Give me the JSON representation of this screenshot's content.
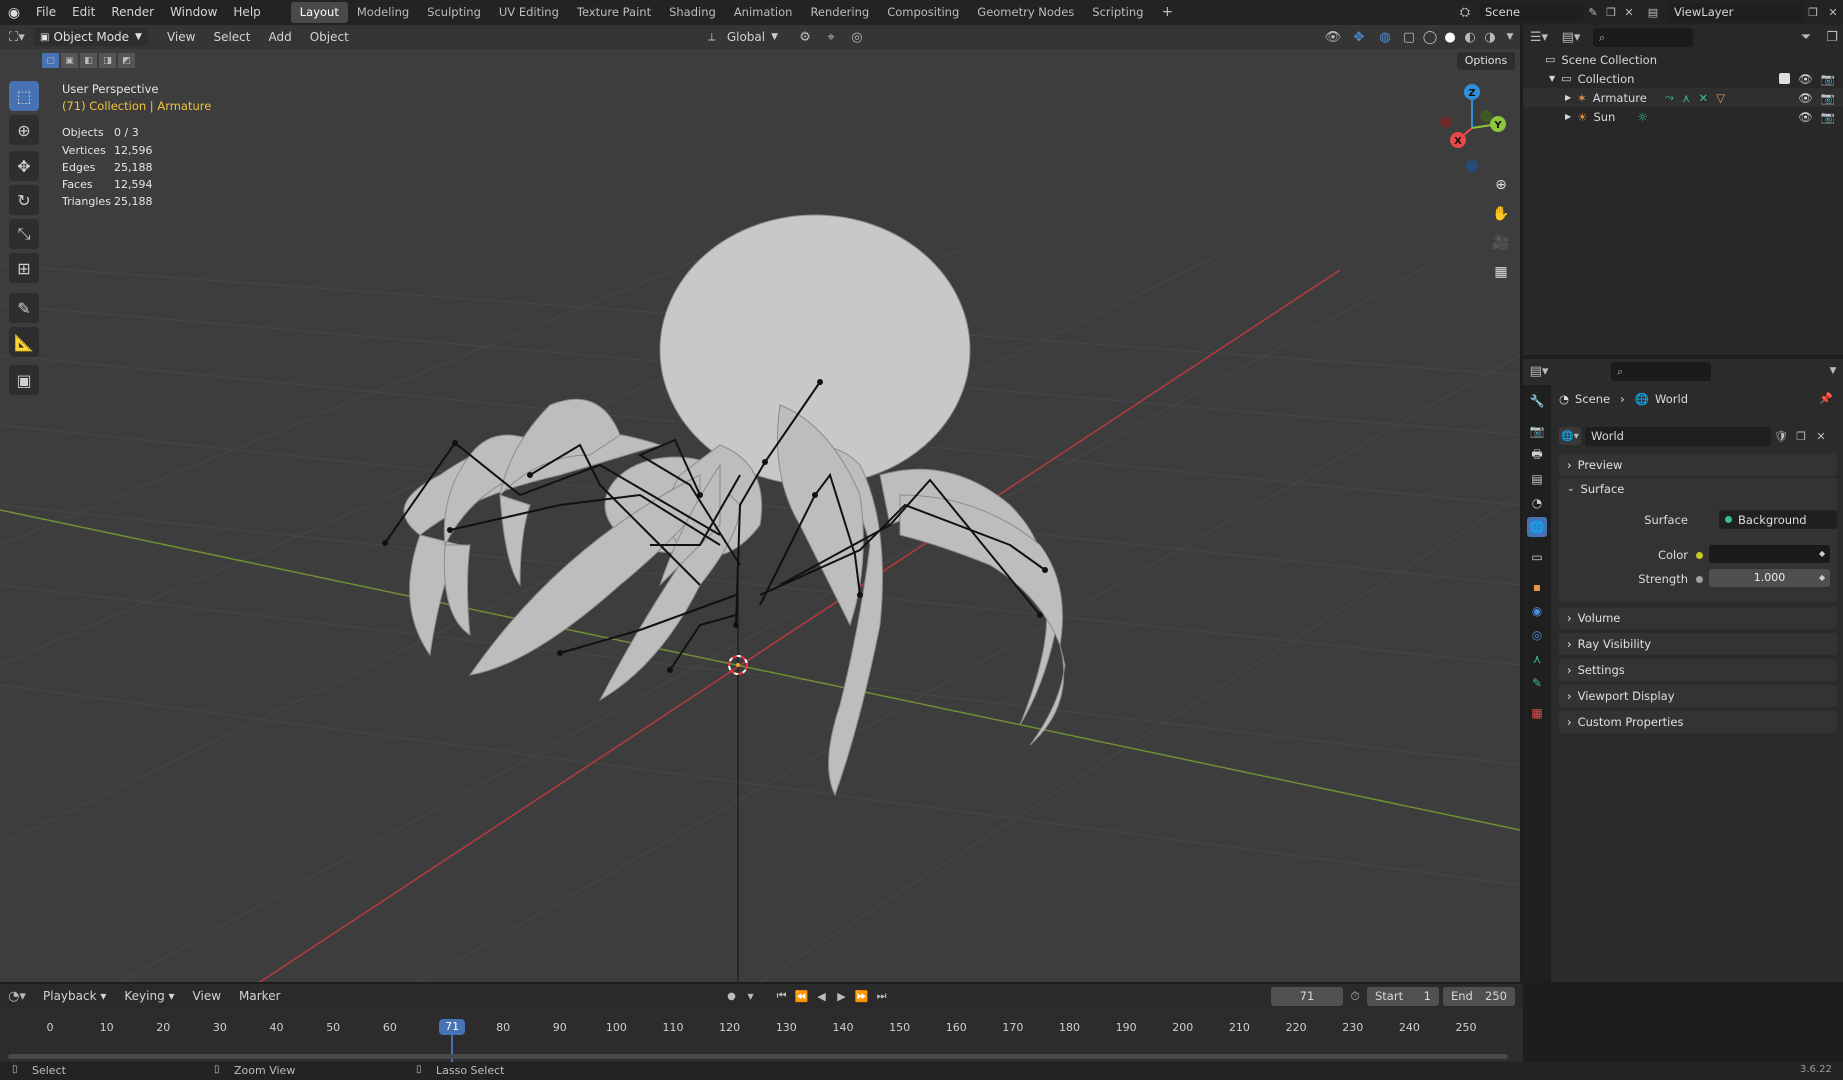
{
  "topbar": {
    "menus": [
      "File",
      "Edit",
      "Render",
      "Window",
      "Help"
    ],
    "workspaces": [
      "Layout",
      "Modeling",
      "Sculpting",
      "UV Editing",
      "Texture Paint",
      "Shading",
      "Animation",
      "Rendering",
      "Compositing",
      "Geometry Nodes",
      "Scripting"
    ],
    "active_workspace": "Layout",
    "add_tab": "+",
    "scene": "Scene",
    "view_layer": "ViewLayer"
  },
  "viewport": {
    "mode": "Object Mode",
    "menus": [
      "View",
      "Select",
      "Add",
      "Object"
    ],
    "transform_orientation": "Global",
    "options_label": "Options",
    "view_name": "User Perspective",
    "context": "(71) Collection | Armature",
    "stats": [
      {
        "label": "Objects",
        "value": "0 / 3"
      },
      {
        "label": "Vertices",
        "value": "12,596"
      },
      {
        "label": "Edges",
        "value": "25,188"
      },
      {
        "label": "Faces",
        "value": "12,594"
      },
      {
        "label": "Triangles",
        "value": "25,188"
      }
    ],
    "gizmo": {
      "x": "X",
      "y": "Y",
      "z": "Z"
    },
    "colors": {
      "x_axis": "#e8484a",
      "y_axis": "#8cc63f",
      "z_axis": "#2f8fdc",
      "grid": "#4a4a4a",
      "background": "#3d3d3d",
      "selection": "#4772b3"
    }
  },
  "outliner": {
    "root": "Scene Collection",
    "items": [
      {
        "name": "Collection",
        "icon": "collection-icon"
      },
      {
        "name": "Armature",
        "icon": "armature-icon"
      },
      {
        "name": "Sun",
        "icon": "light-icon"
      }
    ]
  },
  "properties": {
    "breadcrumb": [
      "Scene",
      "World"
    ],
    "datablock": "World",
    "panels": {
      "preview": "Preview",
      "surface": "Surface",
      "volume": "Volume",
      "ray_visibility": "Ray Visibility",
      "settings": "Settings",
      "viewport_display": "Viewport Display",
      "custom_properties": "Custom Properties"
    },
    "surface_label": "Surface",
    "surface_value": "Background",
    "color_label": "Color",
    "strength_label": "Strength",
    "strength_value": "1.000"
  },
  "timeline": {
    "menus": [
      "Playback",
      "Keying",
      "View",
      "Marker"
    ],
    "current_frame": "71",
    "start_label": "Start",
    "start_value": "1",
    "end_label": "End",
    "end_value": "250",
    "ticks": [
      "0",
      "10",
      "20",
      "30",
      "40",
      "50",
      "60",
      "70",
      "80",
      "90",
      "100",
      "110",
      "120",
      "130",
      "140",
      "150",
      "160",
      "170",
      "180",
      "190",
      "200",
      "210",
      "220",
      "230",
      "240",
      "250"
    ],
    "current_frame_value": 71,
    "frame_min": 0,
    "frame_max": 250
  },
  "statusbar": {
    "select": "Select",
    "zoom": "Zoom View",
    "lasso": "Lasso Select",
    "version": "3.6.22"
  }
}
